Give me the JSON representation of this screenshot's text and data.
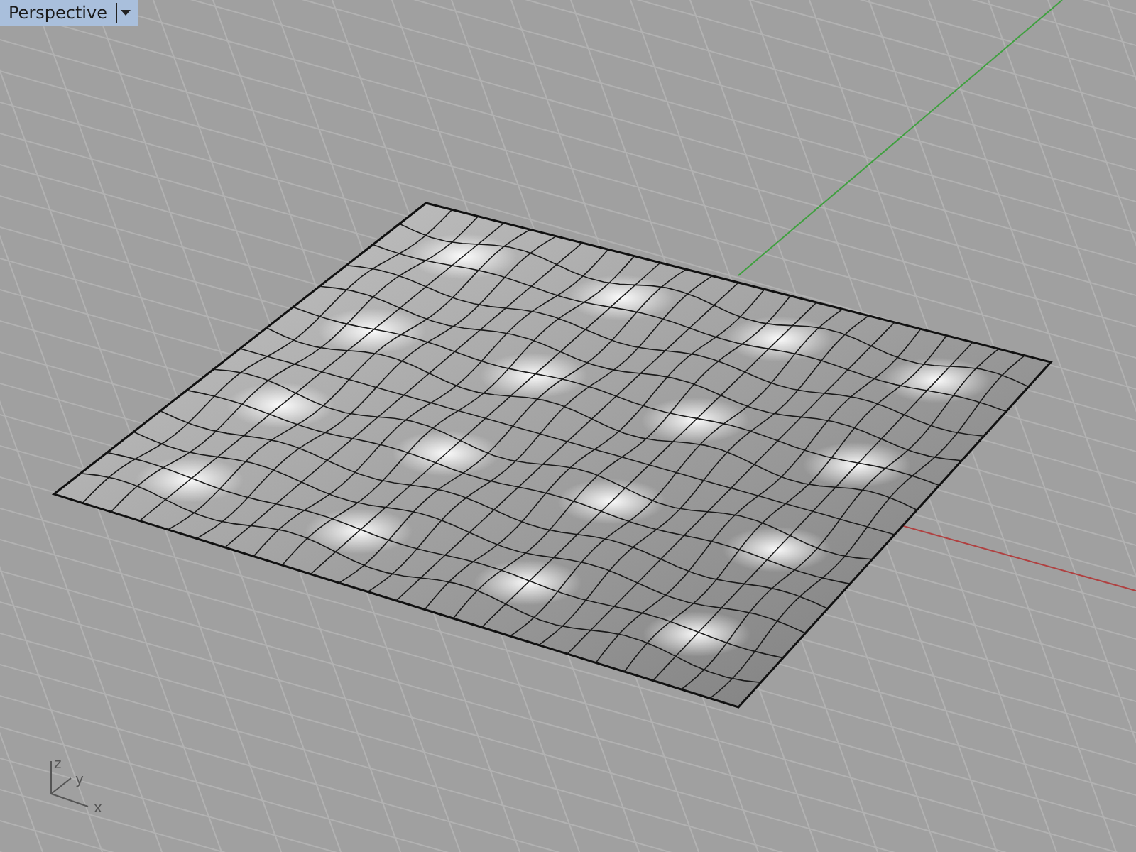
{
  "viewport": {
    "title": "Perspective"
  },
  "axis_widget": {
    "labels": [
      "z",
      "y",
      "x"
    ]
  }
}
